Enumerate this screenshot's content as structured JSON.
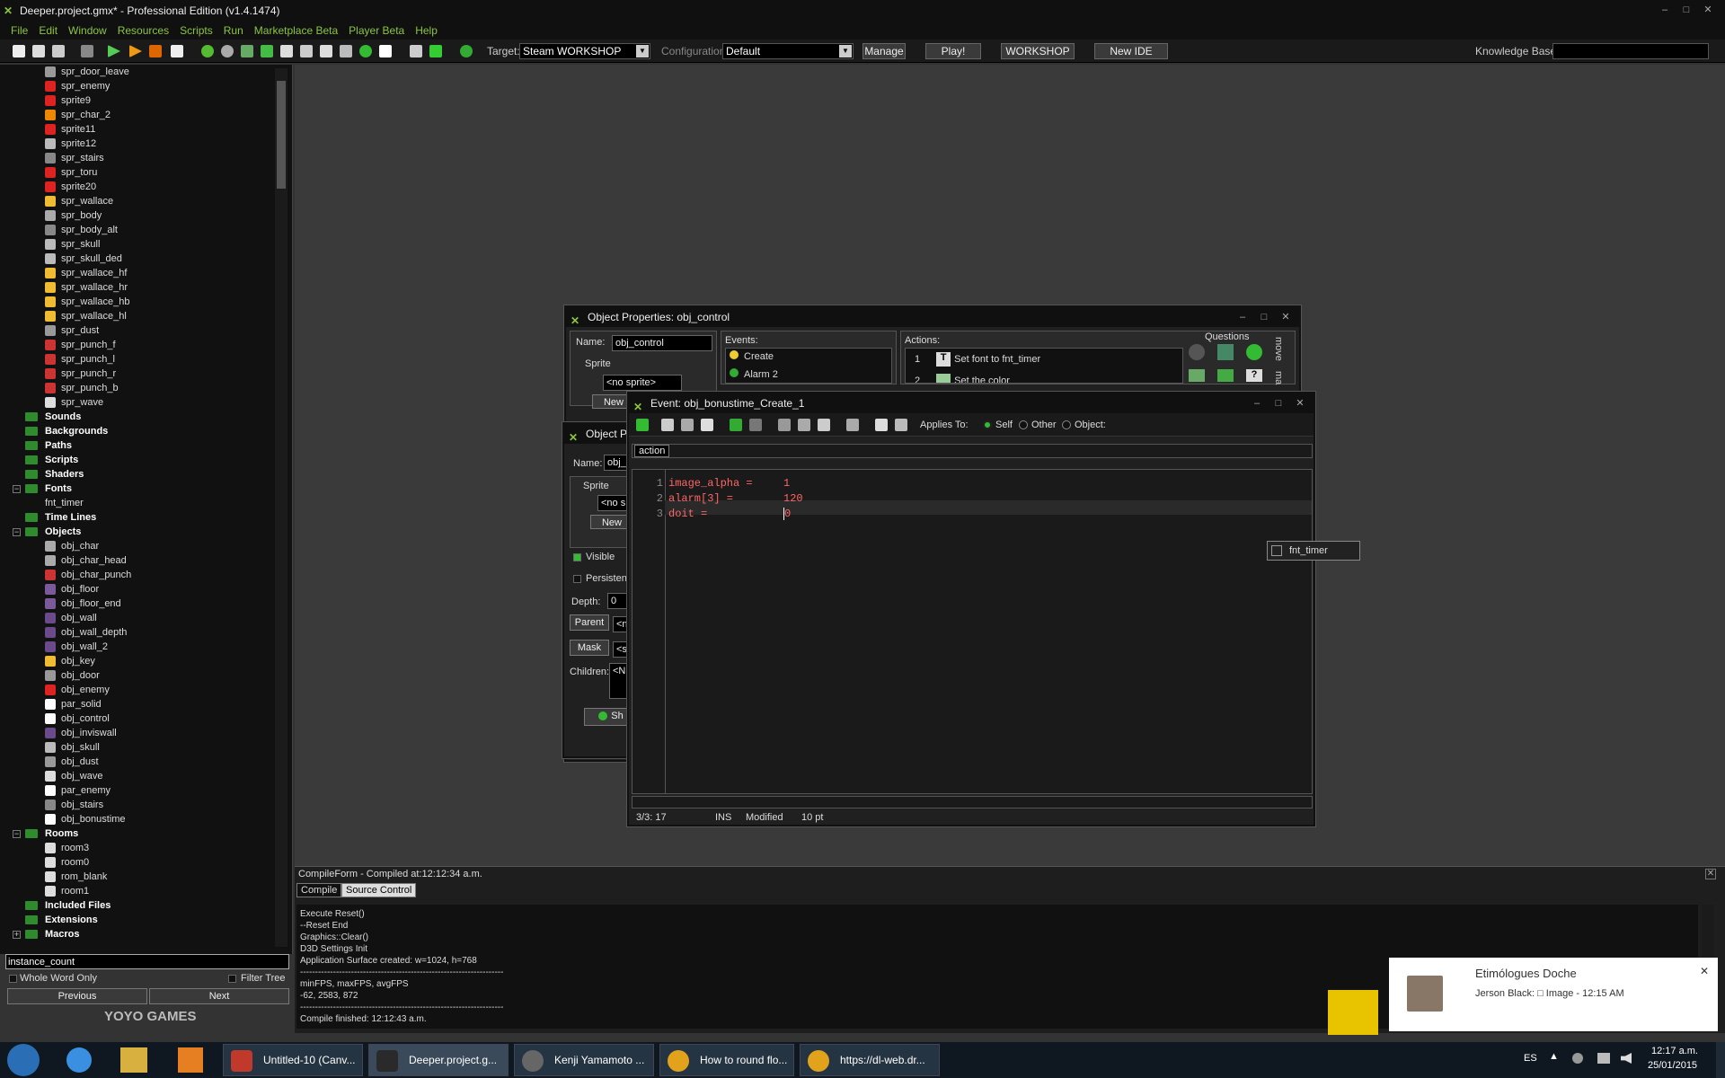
{
  "titlebar": {
    "title": "Deeper.project.gmx* - Professional Edition (v1.4.1474)"
  },
  "menu": [
    "File",
    "Edit",
    "Window",
    "Resources",
    "Scripts",
    "Run",
    "Marketplace Beta",
    "Player Beta",
    "Help"
  ],
  "toolbar": {
    "target_label": "Target:",
    "target_value": "Steam WORKSHOP",
    "config_label": "Configuration:",
    "config_value": "Default",
    "manage": "Manage",
    "play": "Play!",
    "workshop": "WORKSHOP",
    "new_ide": "New IDE",
    "kb_label": "Knowledge Base:"
  },
  "tree": {
    "sprites": [
      "spr_door_leave",
      "spr_enemy",
      "sprite9",
      "spr_char_2",
      "sprite11",
      "sprite12",
      "spr_stairs",
      "spr_toru",
      "sprite20",
      "spr_wallace",
      "spr_body",
      "spr_body_alt",
      "spr_skull",
      "spr_skull_ded",
      "spr_wallace_hf",
      "spr_wallace_hr",
      "spr_wallace_hb",
      "spr_wallace_hl",
      "spr_dust",
      "spr_punch_f",
      "spr_punch_l",
      "spr_punch_r",
      "spr_punch_b",
      "spr_wave"
    ],
    "folders1": [
      "Sounds",
      "Backgrounds",
      "Paths",
      "Scripts",
      "Shaders"
    ],
    "fonts_label": "Fonts",
    "fonts": [
      "fnt_timer"
    ],
    "timelines": "Time Lines",
    "objects_label": "Objects",
    "objects": [
      "obj_char",
      "obj_char_head",
      "obj_char_punch",
      "obj_floor",
      "obj_floor_end",
      "obj_wall",
      "obj_wall_depth",
      "obj_wall_2",
      "obj_key",
      "obj_door",
      "obj_enemy",
      "par_solid",
      "obj_control",
      "obj_inviswall",
      "obj_skull",
      "obj_dust",
      "obj_wave",
      "par_enemy",
      "obj_stairs",
      "obj_bonustime"
    ],
    "rooms_label": "Rooms",
    "rooms": [
      "room3",
      "room0",
      "rom_blank",
      "room1"
    ],
    "folders2": [
      "Included Files",
      "Extensions",
      "Macros"
    ]
  },
  "search": {
    "value": "instance_count",
    "whole_word": "Whole Word Only",
    "filter_tree": "Filter Tree",
    "previous": "Previous",
    "next": "Next",
    "logo": "YOYO GAMES"
  },
  "objwin": {
    "title": "Object Properties: obj_control",
    "name_label": "Name:",
    "name_value": "obj_control",
    "sprite_label": "Sprite",
    "sprite_value": "<no sprite>",
    "new": "New",
    "events_label": "Events:",
    "events": [
      "Create",
      "Alarm 2"
    ],
    "actions_label": "Actions:",
    "actions": [
      {
        "num": "1",
        "text": "Set font to fnt_timer"
      },
      {
        "num": "2",
        "text": "Set the color"
      }
    ],
    "questions": "Questions",
    "tabs": [
      "move",
      "ma"
    ]
  },
  "objwin2": {
    "title": "Object P",
    "name_label": "Name:",
    "name_value": "obj_",
    "sprite_label": "Sprite",
    "sprite_value": "<no s",
    "new": "New",
    "visible": "Visible",
    "persistent": "Persistent",
    "depth_label": "Depth:",
    "depth_value": "0",
    "parent": "Parent",
    "parent_value": "<n",
    "mask": "Mask",
    "mask_value": "<s",
    "children_label": "Children:",
    "children_value": "<N",
    "show": "Sh"
  },
  "eventwin": {
    "title": "Event: obj_bonustime_Create_1",
    "applies_to": "Applies To:",
    "self": "Self",
    "other": "Other",
    "object": "Object:",
    "tab": "action",
    "code": [
      {
        "n": "1",
        "var": "image_alpha =",
        "val": "1"
      },
      {
        "n": "2",
        "var": "alarm[3] =",
        "val": "120"
      },
      {
        "n": "3",
        "var": "doit =",
        "val": "0"
      }
    ],
    "autocomplete": "fnt_timer",
    "status_pos": "3/3: 17",
    "status_mode": "INS",
    "status_mod": "Modified",
    "status_size": "10 pt"
  },
  "compile": {
    "title": "CompileForm - Compiled at:12:12:34 a.m.",
    "tabs": [
      "Compile",
      "Source Control"
    ],
    "lines": [
      "Execute Reset()",
      "--Reset End",
      "Graphics::Clear()",
      "D3D Settings Init",
      "Application Surface created: w=1024, h=768",
      "--------------------------------------------------------------------",
      "minFPS, maxFPS, avgFPS",
      "-62, 2583, 872",
      "--------------------------------------------------------------------",
      "Compile finished: 12:12:43 a.m."
    ]
  },
  "toast": {
    "title": "Etimólogues Doche",
    "body": "Jerson Black: □ Image - 12:15 AM"
  },
  "taskbar": {
    "items": [
      "Untitled-10 (Canv...",
      "Deeper.project.g...",
      "Kenji Yamamoto ...",
      "How to round flo...",
      "https://dl-web.dr..."
    ],
    "lang": "ES",
    "time": "12:17 a.m.",
    "date": "25/01/2015"
  },
  "colors": {
    "accent": "#8bc53f",
    "background": "#333333",
    "panel": "#202020"
  }
}
